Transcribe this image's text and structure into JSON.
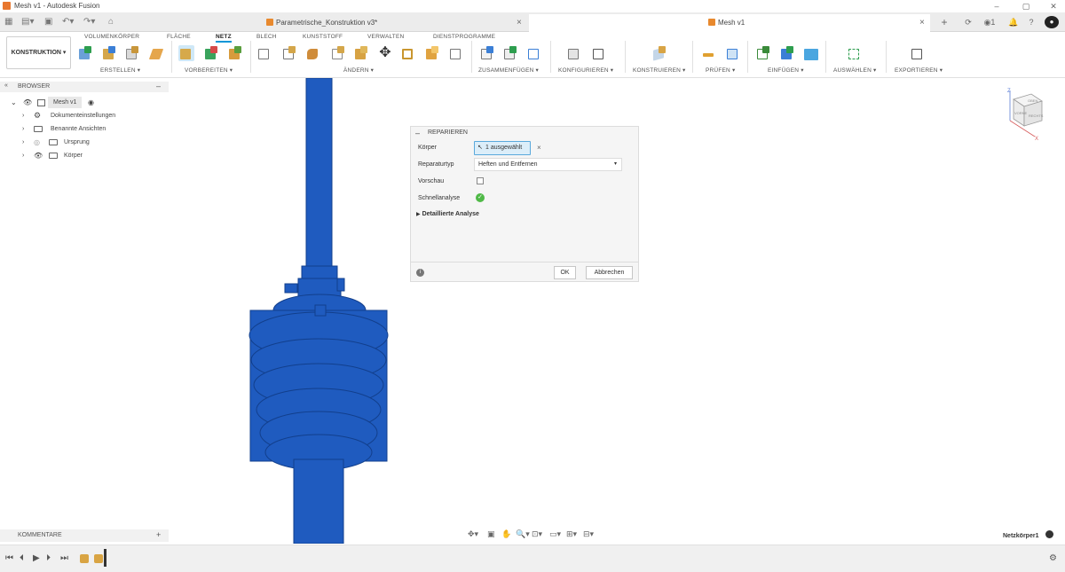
{
  "app": {
    "window_title": "Mesh v1 - Autodesk Fusion",
    "brand_color": "#e8772e",
    "accent_color": "#0696d7"
  },
  "tabs": [
    {
      "label": "Parametrische_Konstruktion v3*",
      "active": false
    },
    {
      "label": "Mesh v1",
      "active": true
    }
  ],
  "tabbar": {
    "notifications": "1"
  },
  "ribbon": {
    "workspace": "KONSTRUKTION",
    "tabs": [
      "VOLUMENKÖRPER",
      "FLÄCHE",
      "NETZ",
      "BLECH",
      "KUNSTSTOFF",
      "VERWALTEN",
      "DIENSTPROGRAMME"
    ],
    "active_tab": "NETZ",
    "groups": [
      "ERSTELLEN",
      "VORBEREITEN",
      "ÄNDERN",
      "ZUSAMMENFÜGEN",
      "KONFIGURIEREN",
      "KONSTRUIEREN",
      "PRÜFEN",
      "EINFÜGEN",
      "AUSWÄHLEN",
      "EXPORTIEREN"
    ]
  },
  "browser": {
    "title": "BROWSER",
    "root": "Mesh v1",
    "items": [
      "Dokumenteinstellungen",
      "Benannte Ansichten",
      "Ursprung",
      "Körper"
    ]
  },
  "repair_panel": {
    "title": "REPARIEREN",
    "body_label": "Körper",
    "body_value": "1 ausgewählt",
    "repair_type_label": "Reparaturtyp",
    "repair_type_value": "Heften und Entfernen",
    "preview_label": "Vorschau",
    "quick_analysis_label": "Schnellanalyse",
    "detailed_analysis_label": "Detaillierte Analyse",
    "ok": "OK",
    "cancel": "Abbrechen"
  },
  "viewcube": {
    "top": "OBEN",
    "left": "VORNE",
    "right": "RECHTS",
    "axis_z": "Z",
    "axis_x": "X"
  },
  "comments": {
    "title": "KOMMENTARE"
  },
  "status": {
    "selection": "Netzkörper1"
  },
  "mesh_color": "#1f5bbf"
}
